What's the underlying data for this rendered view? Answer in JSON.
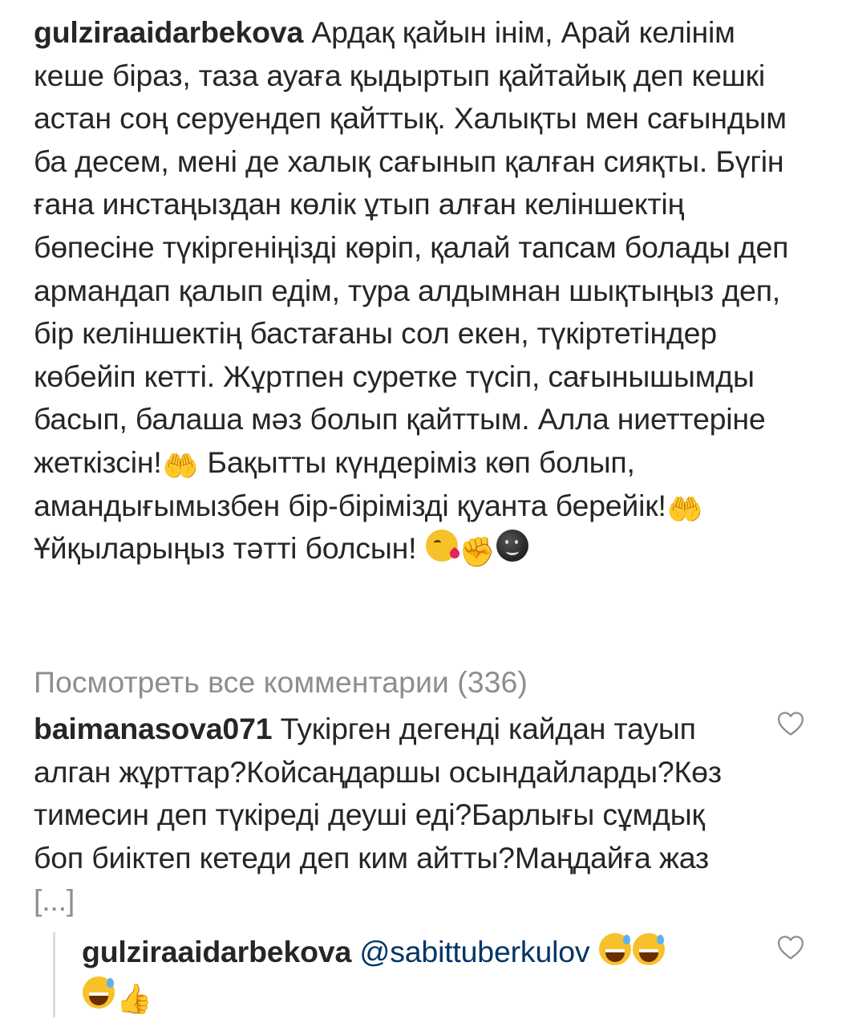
{
  "caption": {
    "username": "gulziraaidarbekova",
    "text_part1": "Ардақ қайын інім, Арай келінім кеше біраз, таза ауаға қыдыртып қайтайық деп кешкі астан соң серуендеп қайттық. Халықты мен сағындым ба десем, мені де халық сағынып қалған сияқты. Бүгін ғана инстаңыздан көлік ұтып алған келіншектің бөпесіне түкіргеніңізді көріп, қалай тапсам болады деп армандап қалып едім, тура алдымнан шықтыңыз деп, бір келіншектің бастағаны сол екен, түкіртетіндер көбейіп кетті. Жұртпен суретке түсіп, сағынышымды басып, балаша мәз болып қайттым. Алла ниеттеріне жеткізсін!",
    "text_part2": " Бақытты күндеріміз көп болып, амандығымызбен бір-бірімізді қуанта берейік!",
    "text_part3": " Ұйқыларыңыз тәтті болсын! ",
    "emoji_hands": "🤲",
    "emoji_fist": "✊"
  },
  "view_all_comments": "Посмотреть все комментарии (336)",
  "comment": {
    "username": "baimanasova071",
    "text": "Тукірген дегенді кайдан тауып алган жұрттар?Койсаңдаршы осындайларды?Көз тимесин деп түкіреді деуші еді?Барлығы сұмдық боп биіктеп кетеди деп ким айтты?Маңдайға жаз",
    "more": "[...]"
  },
  "reply": {
    "username": "gulziraaidarbekova",
    "mention": "@sabittuberkulov",
    "emoji_thumb": "👍"
  },
  "icons": {
    "like": "heart-outline-icon"
  },
  "colors": {
    "text": "#262626",
    "muted": "#8e8e8e",
    "mention": "#003569",
    "thread_line": "#dbdbdb"
  }
}
